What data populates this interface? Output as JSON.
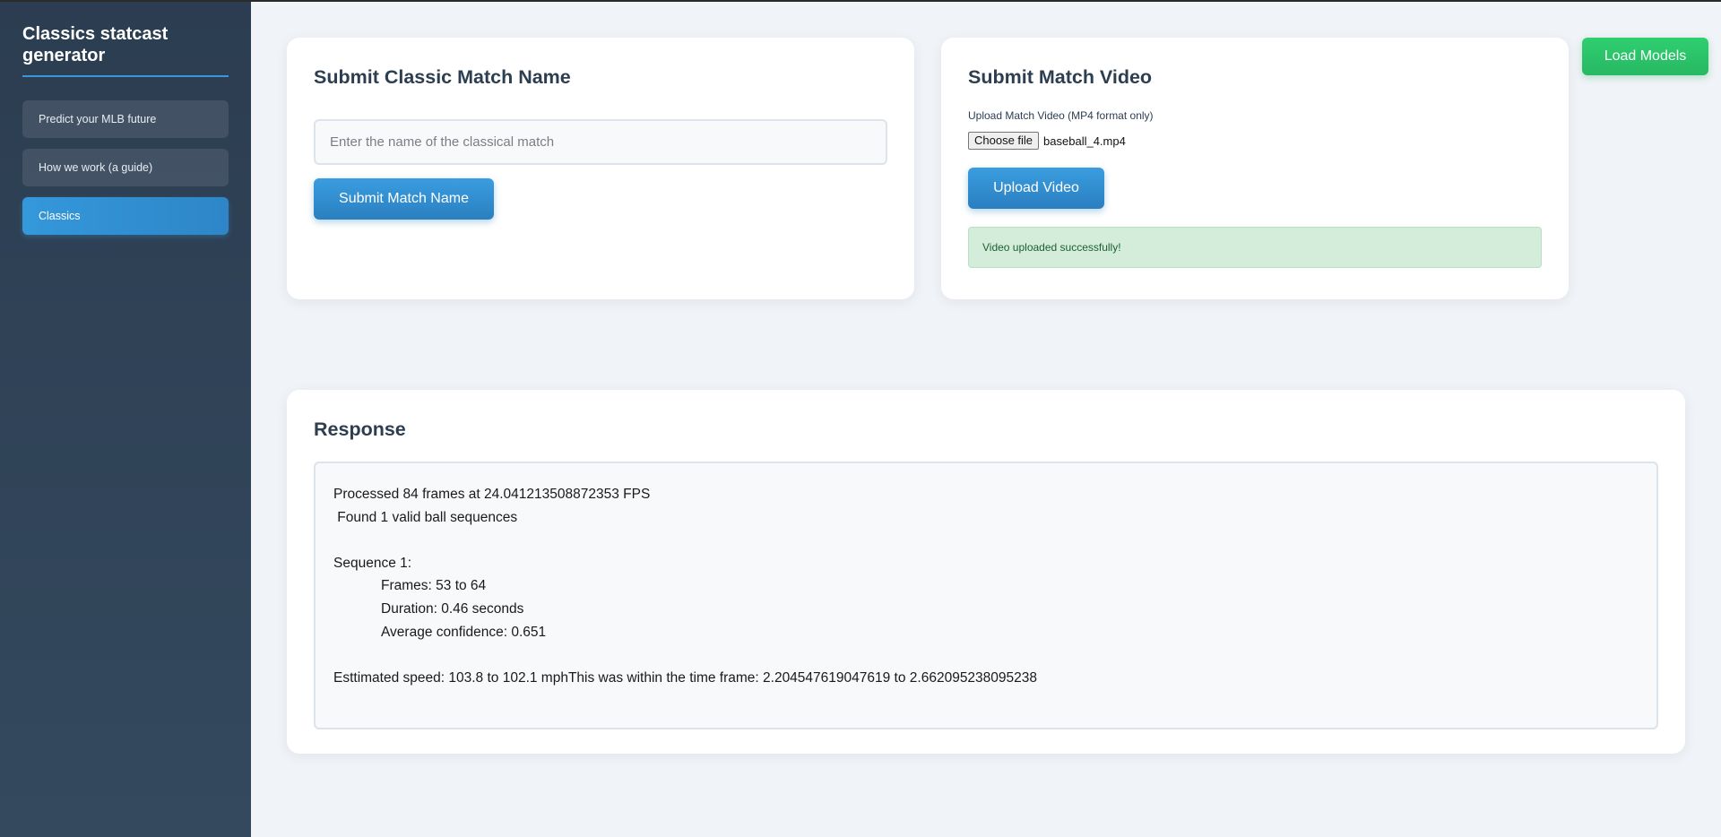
{
  "sidebar": {
    "title": "Classics statcast generator",
    "items": [
      {
        "label": "Predict your MLB future",
        "active": false
      },
      {
        "label": "How we work (a guide)",
        "active": false
      },
      {
        "label": "Classics",
        "active": true
      }
    ]
  },
  "match_name_card": {
    "title": "Submit Classic Match Name",
    "input_placeholder": "Enter the name of the classical match",
    "input_value": "",
    "submit_label": "Submit Match Name"
  },
  "video_card": {
    "title": "Submit Match Video",
    "upload_label": "Upload Match Video (MP4 format only)",
    "choose_file_label": "Choose file",
    "file_name": "baseball_4.mp4",
    "upload_button_label": "Upload Video",
    "success_message": "Video uploaded successfully!"
  },
  "header_actions": {
    "load_models_label": "Load Models"
  },
  "response": {
    "title": "Response",
    "lines": {
      "processed": "Processed 84 frames at 24.041213508872353 FPS",
      "found": " Found 1 valid ball sequences",
      "sequence": "Sequence 1:",
      "frames": "Frames: 53 to 64",
      "duration": "Duration: 0.46 seconds",
      "confidence": "Average confidence: 0.651",
      "speed": "Esttimated speed: 103.8 to 102.1 mphThis was within the time frame: 2.204547619047619 to 2.662095238095238"
    }
  },
  "colors": {
    "accent_blue": "#3498db",
    "success_green": "#2ecc71",
    "sidebar_bg": "#2c3e50"
  }
}
